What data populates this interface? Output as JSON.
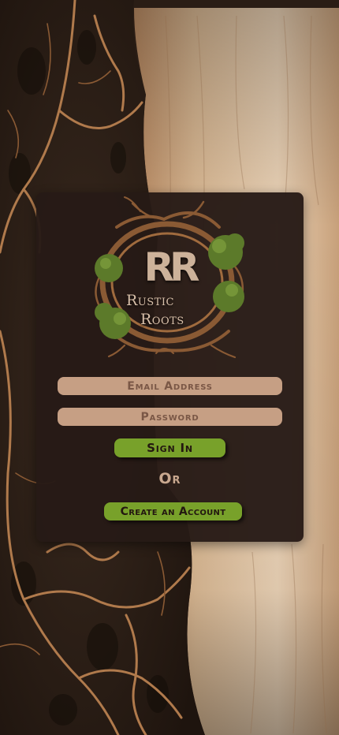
{
  "background": {
    "bark_color": "#2b1d15",
    "parchment_color": "#d4b08c",
    "root_color": "#b07a4c"
  },
  "logo": {
    "monogram": "RR",
    "word_1": "Rustic",
    "word_2": "Roots",
    "leaf_color": "#5c7a2a",
    "branch_color": "#8a5a34"
  },
  "form": {
    "email_placeholder": "Email Address",
    "password_placeholder": "Password",
    "sign_in_label": "Sign In",
    "or_label": "Or",
    "create_account_label": "Create an Account"
  },
  "colors": {
    "card": "#261a16",
    "field": "#c69f84",
    "button": "#78a12a"
  }
}
